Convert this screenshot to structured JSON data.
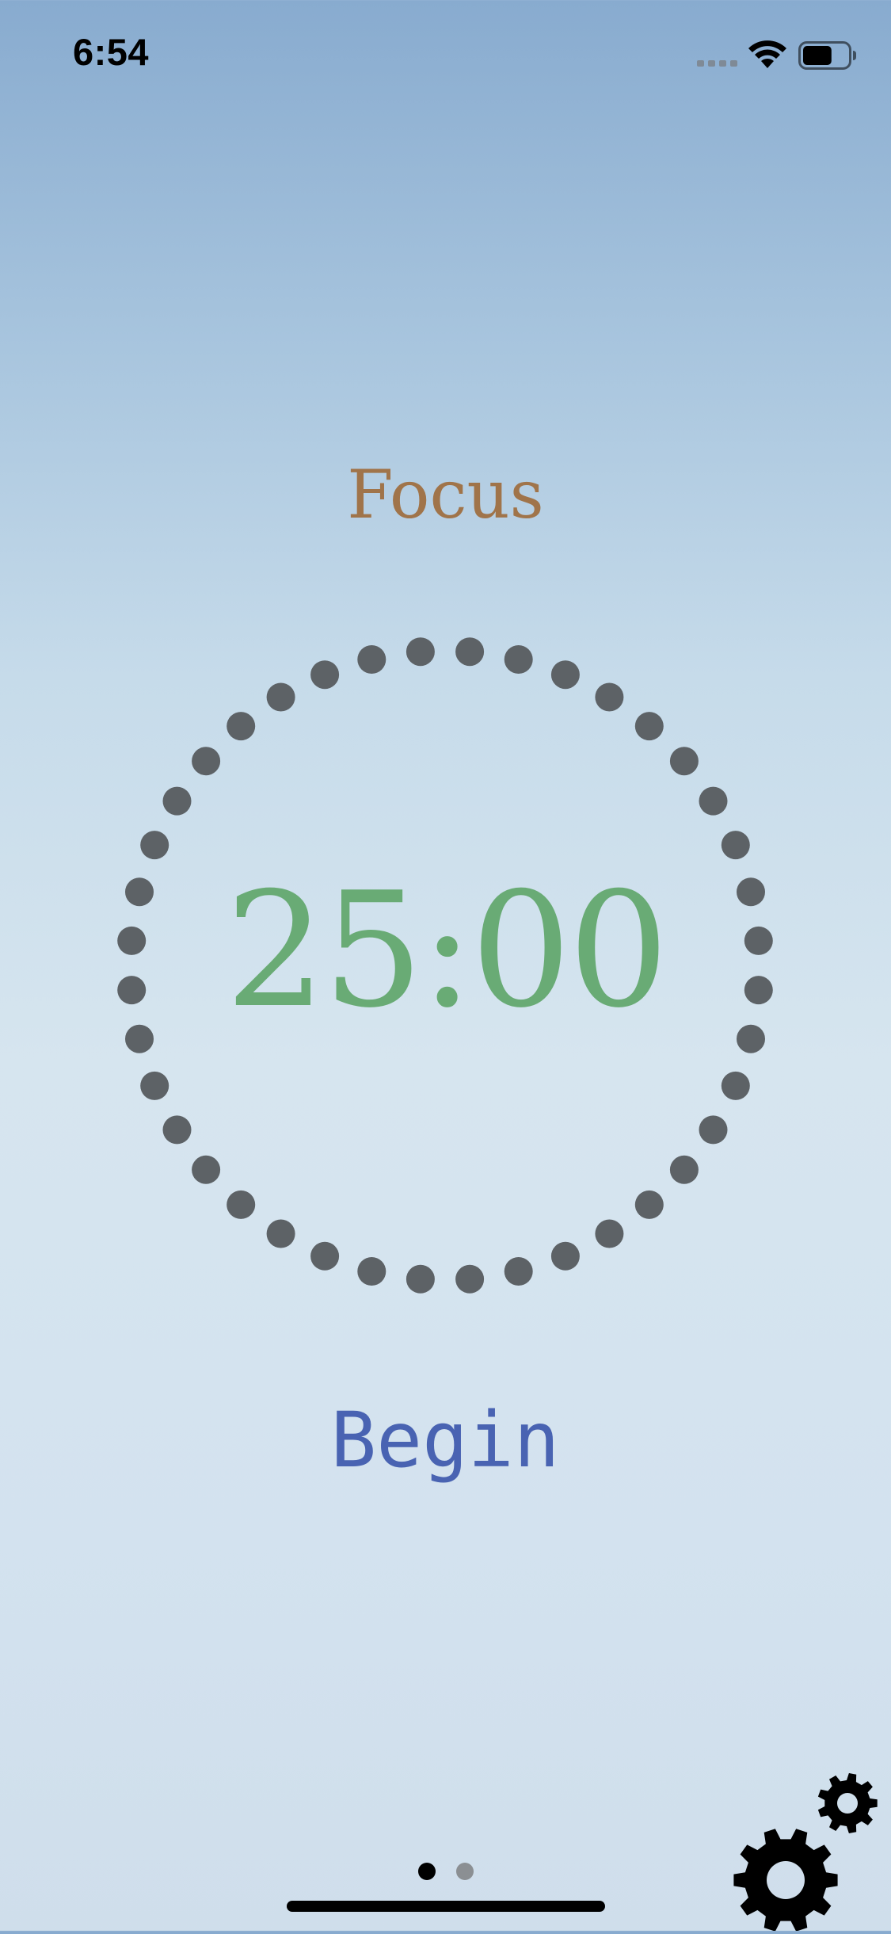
{
  "status_bar": {
    "time": "6:54",
    "signal_icon": "cellular-signal-icon",
    "wifi_icon": "wifi-icon",
    "battery_icon": "battery-icon",
    "battery_level": 0.65
  },
  "timer": {
    "mode_label": "Focus",
    "time_remaining": "25:00",
    "tick_count": 40,
    "dot_color": "#5d6266",
    "mode_color": "#a0744a",
    "time_color": "#69ab75"
  },
  "actions": {
    "begin_label": "Begin",
    "begin_color": "#4963b2",
    "settings_icon": "gears-icon"
  },
  "pager": {
    "page_count": 2,
    "current_page": 1
  }
}
